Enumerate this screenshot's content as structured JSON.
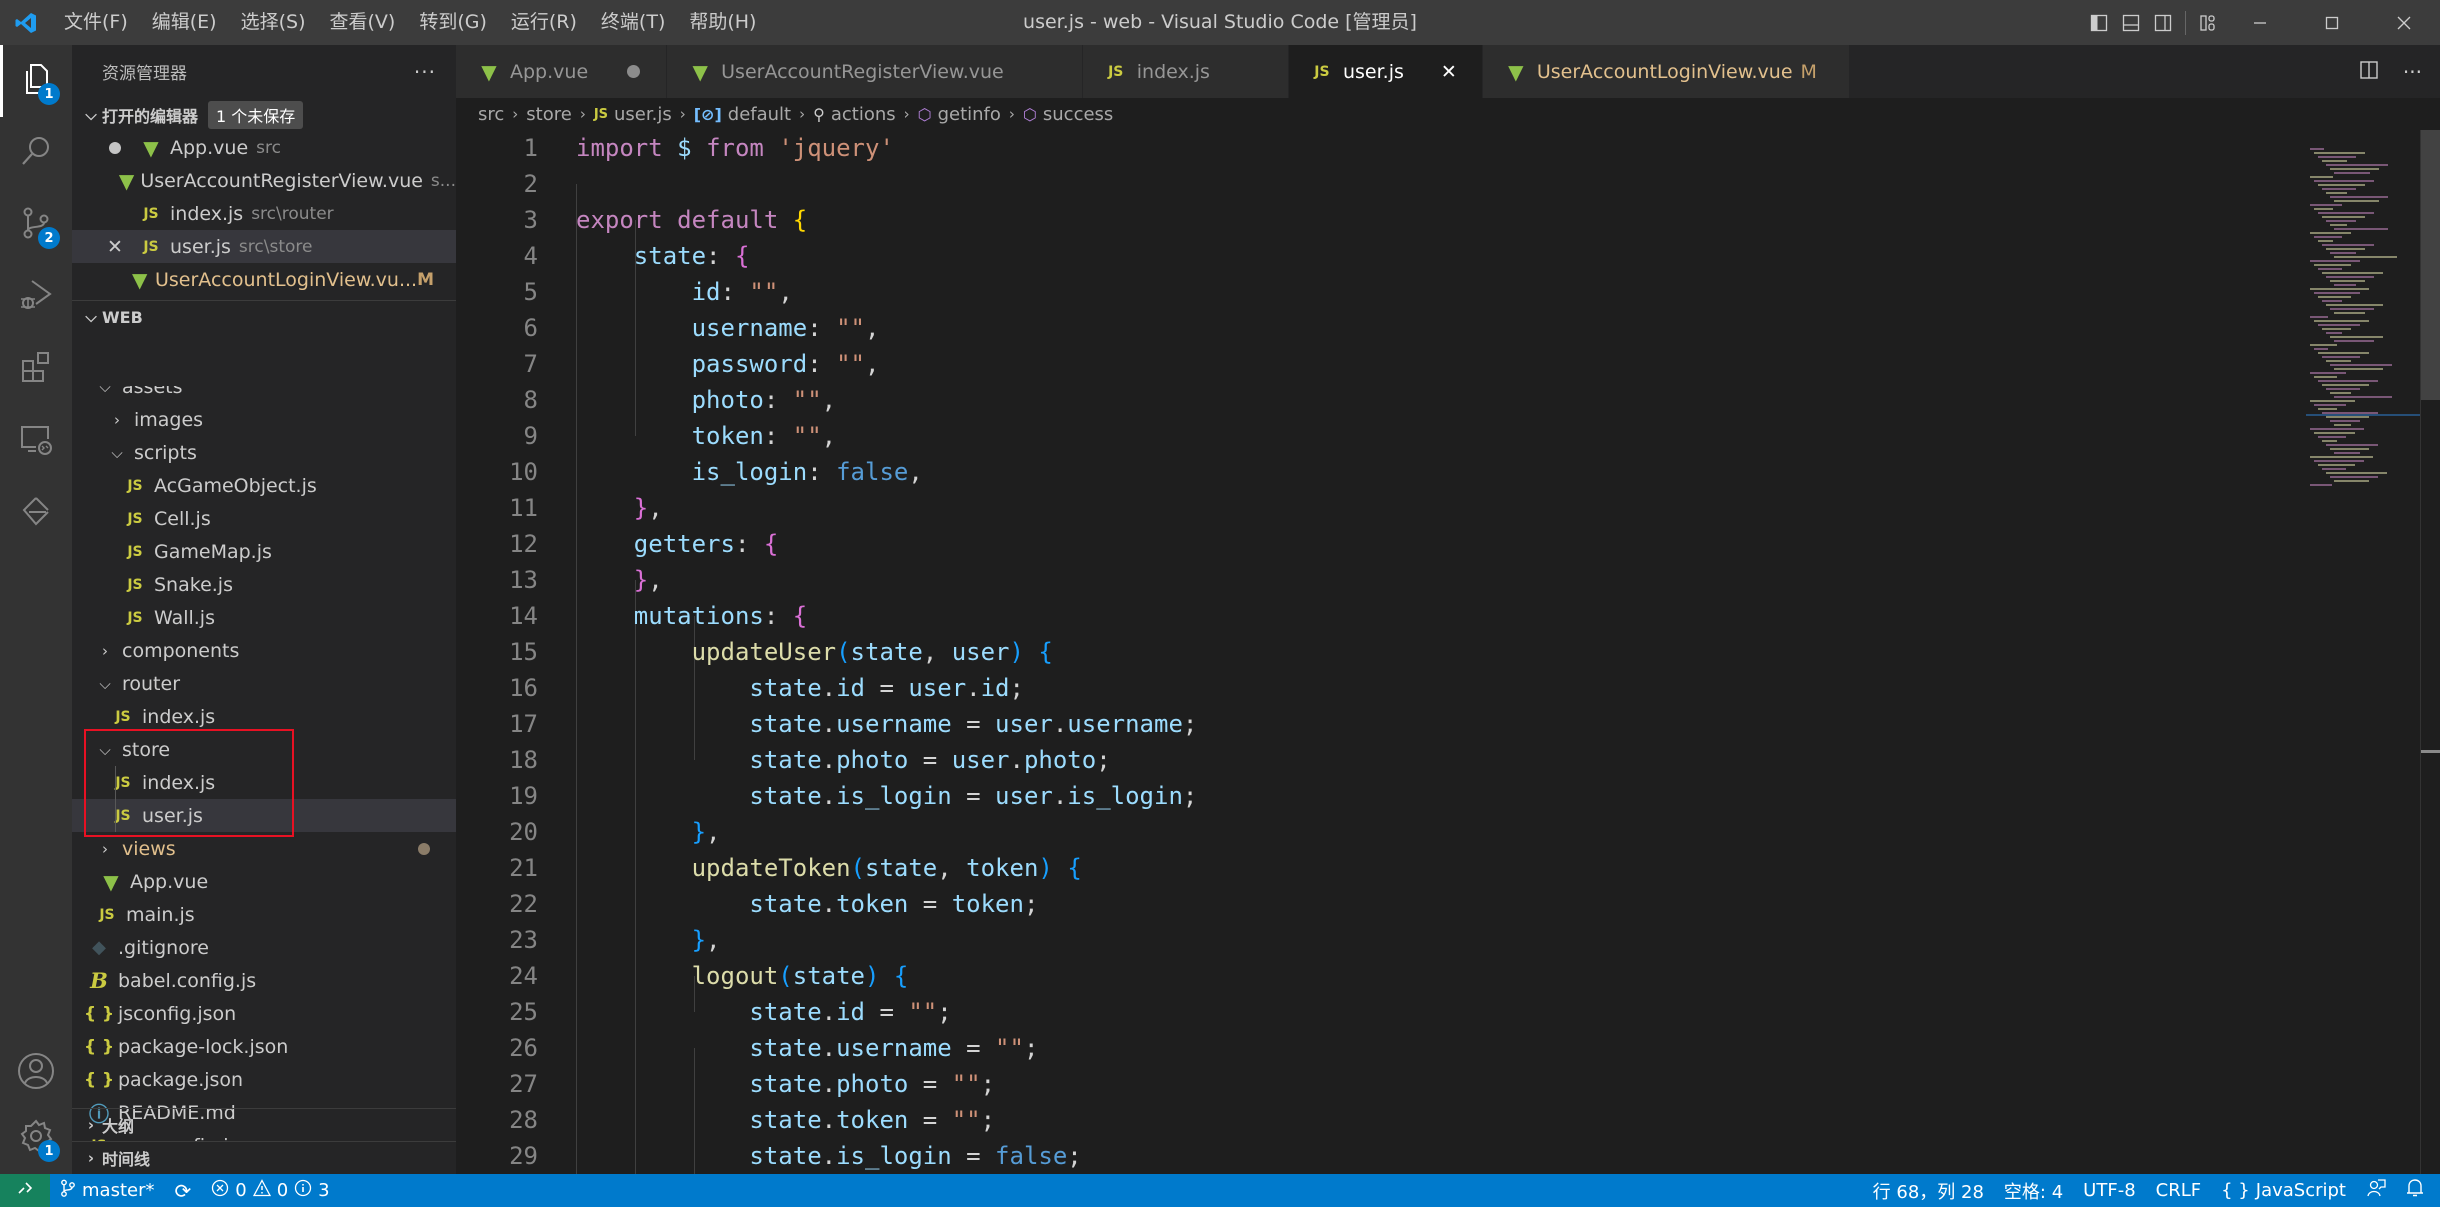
{
  "titlebar": {
    "menu": [
      "文件(F)",
      "编辑(E)",
      "选择(S)",
      "查看(V)",
      "转到(G)",
      "运行(R)",
      "终端(T)",
      "帮助(H)"
    ],
    "window_title": "user.js - web - Visual Studio Code [管理员]"
  },
  "activitybar": {
    "explorer_badge": "1",
    "scm_badge": "2",
    "settings_badge": "1"
  },
  "sidebar": {
    "title": "资源管理器",
    "more": "···",
    "open_editors": {
      "label": "打开的编辑器",
      "unsaved_badge": "1 个未保存",
      "items": [
        {
          "name": "App.vue",
          "desc": "src",
          "type": "vue",
          "state": "dirty"
        },
        {
          "name": "UserAccountRegisterView.vue",
          "desc": "s...",
          "type": "vue",
          "state": ""
        },
        {
          "name": "index.js",
          "desc": "src\\router",
          "type": "js",
          "state": ""
        },
        {
          "name": "user.js",
          "desc": "src\\store",
          "type": "js",
          "state": "active"
        },
        {
          "name": "UserAccountLoginView.vu...",
          "desc": "M",
          "type": "vue",
          "state": "modified"
        }
      ]
    },
    "workspace": {
      "label": "WEB",
      "tree": [
        {
          "name": "assets",
          "kind": "folder-open",
          "depth": 1
        },
        {
          "name": "images",
          "kind": "folder-closed",
          "depth": 2
        },
        {
          "name": "scripts",
          "kind": "folder-open",
          "depth": 2
        },
        {
          "name": "AcGameObject.js",
          "kind": "js",
          "depth": 3
        },
        {
          "name": "Cell.js",
          "kind": "js",
          "depth": 3
        },
        {
          "name": "GameMap.js",
          "kind": "js",
          "depth": 3
        },
        {
          "name": "Snake.js",
          "kind": "js",
          "depth": 3
        },
        {
          "name": "Wall.js",
          "kind": "js",
          "depth": 3
        },
        {
          "name": "components",
          "kind": "folder-closed",
          "depth": 1
        },
        {
          "name": "router",
          "kind": "folder-open",
          "depth": 1
        },
        {
          "name": "index.js",
          "kind": "js",
          "depth": 2
        },
        {
          "name": "store",
          "kind": "folder-open",
          "depth": 1
        },
        {
          "name": "index.js",
          "kind": "js",
          "depth": 2
        },
        {
          "name": "user.js",
          "kind": "js",
          "depth": 2,
          "selected": true
        },
        {
          "name": "views",
          "kind": "folder-closed-modified",
          "depth": 1
        },
        {
          "name": "App.vue",
          "kind": "vue",
          "depth": 1
        },
        {
          "name": "main.js",
          "kind": "js",
          "depth": 1
        },
        {
          "name": ".gitignore",
          "kind": "git",
          "depth": 0
        },
        {
          "name": "babel.config.js",
          "kind": "babel",
          "depth": 0
        },
        {
          "name": "jsconfig.json",
          "kind": "json",
          "depth": 0
        },
        {
          "name": "package-lock.json",
          "kind": "json",
          "depth": 0
        },
        {
          "name": "package.json",
          "kind": "json",
          "depth": 0
        },
        {
          "name": "README.md",
          "kind": "info",
          "depth": 0
        },
        {
          "name": "vue.config.js",
          "kind": "js",
          "depth": 0
        }
      ]
    },
    "outline_label": "大纲",
    "timeline_label": "时间线"
  },
  "tabs": [
    {
      "label": "App.vue",
      "type": "vue",
      "state": "dirty"
    },
    {
      "label": "UserAccountRegisterView.vue",
      "type": "vue",
      "state": ""
    },
    {
      "label": "index.js",
      "type": "js",
      "state": ""
    },
    {
      "label": "user.js",
      "type": "js",
      "state": "active"
    },
    {
      "label": "UserAccountLoginView.vue",
      "type": "vue",
      "state": "modified",
      "flag": "M"
    }
  ],
  "breadcrumb": [
    "src",
    "store",
    "user.js",
    "default",
    "actions",
    "getinfo",
    "success"
  ],
  "code_lines": [
    [
      [
        "kw",
        "import"
      ],
      [
        "plain",
        " "
      ],
      [
        "var",
        "$"
      ],
      [
        "plain",
        " "
      ],
      [
        "kw",
        "from"
      ],
      [
        "plain",
        " "
      ],
      [
        "str",
        "'jquery'"
      ]
    ],
    [],
    [
      [
        "kw",
        "export"
      ],
      [
        "plain",
        " "
      ],
      [
        "kw",
        "default"
      ],
      [
        "plain",
        " "
      ],
      [
        "b1",
        "{"
      ]
    ],
    [
      [
        "plain",
        "    "
      ],
      [
        "var",
        "state"
      ],
      [
        "plain",
        ": "
      ],
      [
        "b2",
        "{"
      ]
    ],
    [
      [
        "plain",
        "        "
      ],
      [
        "var",
        "id"
      ],
      [
        "plain",
        ": "
      ],
      [
        "str",
        "\"\""
      ],
      [
        "plain",
        ","
      ]
    ],
    [
      [
        "plain",
        "        "
      ],
      [
        "var",
        "username"
      ],
      [
        "plain",
        ": "
      ],
      [
        "str",
        "\"\""
      ],
      [
        "plain",
        ","
      ]
    ],
    [
      [
        "plain",
        "        "
      ],
      [
        "var",
        "password"
      ],
      [
        "plain",
        ": "
      ],
      [
        "str",
        "\"\""
      ],
      [
        "plain",
        ","
      ]
    ],
    [
      [
        "plain",
        "        "
      ],
      [
        "var",
        "photo"
      ],
      [
        "plain",
        ": "
      ],
      [
        "str",
        "\"\""
      ],
      [
        "plain",
        ","
      ]
    ],
    [
      [
        "plain",
        "        "
      ],
      [
        "var",
        "token"
      ],
      [
        "plain",
        ": "
      ],
      [
        "str",
        "\"\""
      ],
      [
        "plain",
        ","
      ]
    ],
    [
      [
        "plain",
        "        "
      ],
      [
        "var",
        "is_login"
      ],
      [
        "plain",
        ": "
      ],
      [
        "bool",
        "false"
      ],
      [
        "plain",
        ","
      ]
    ],
    [
      [
        "plain",
        "    "
      ],
      [
        "b2",
        "}"
      ],
      [
        "plain",
        ","
      ]
    ],
    [
      [
        "plain",
        "    "
      ],
      [
        "var",
        "getters"
      ],
      [
        "plain",
        ": "
      ],
      [
        "b2",
        "{"
      ]
    ],
    [
      [
        "plain",
        "    "
      ],
      [
        "b2",
        "}"
      ],
      [
        "plain",
        ","
      ]
    ],
    [
      [
        "plain",
        "    "
      ],
      [
        "var",
        "mutations"
      ],
      [
        "plain",
        ": "
      ],
      [
        "b2",
        "{"
      ]
    ],
    [
      [
        "plain",
        "        "
      ],
      [
        "fn",
        "updateUser"
      ],
      [
        "b3",
        "("
      ],
      [
        "var",
        "state"
      ],
      [
        "plain",
        ", "
      ],
      [
        "var",
        "user"
      ],
      [
        "b3",
        ")"
      ],
      [
        "plain",
        " "
      ],
      [
        "b3",
        "{"
      ]
    ],
    [
      [
        "plain",
        "            "
      ],
      [
        "var",
        "state"
      ],
      [
        "plain",
        "."
      ],
      [
        "var",
        "id"
      ],
      [
        "plain",
        " = "
      ],
      [
        "var",
        "user"
      ],
      [
        "plain",
        "."
      ],
      [
        "var",
        "id"
      ],
      [
        "plain",
        ";"
      ]
    ],
    [
      [
        "plain",
        "            "
      ],
      [
        "var",
        "state"
      ],
      [
        "plain",
        "."
      ],
      [
        "var",
        "username"
      ],
      [
        "plain",
        " = "
      ],
      [
        "var",
        "user"
      ],
      [
        "plain",
        "."
      ],
      [
        "var",
        "username"
      ],
      [
        "plain",
        ";"
      ]
    ],
    [
      [
        "plain",
        "            "
      ],
      [
        "var",
        "state"
      ],
      [
        "plain",
        "."
      ],
      [
        "var",
        "photo"
      ],
      [
        "plain",
        " = "
      ],
      [
        "var",
        "user"
      ],
      [
        "plain",
        "."
      ],
      [
        "var",
        "photo"
      ],
      [
        "plain",
        ";"
      ]
    ],
    [
      [
        "plain",
        "            "
      ],
      [
        "var",
        "state"
      ],
      [
        "plain",
        "."
      ],
      [
        "var",
        "is_login"
      ],
      [
        "plain",
        " = "
      ],
      [
        "var",
        "user"
      ],
      [
        "plain",
        "."
      ],
      [
        "var",
        "is_login"
      ],
      [
        "plain",
        ";"
      ]
    ],
    [
      [
        "plain",
        "        "
      ],
      [
        "b3",
        "}"
      ],
      [
        "plain",
        ","
      ]
    ],
    [
      [
        "plain",
        "        "
      ],
      [
        "fn",
        "updateToken"
      ],
      [
        "b3",
        "("
      ],
      [
        "var",
        "state"
      ],
      [
        "plain",
        ", "
      ],
      [
        "var",
        "token"
      ],
      [
        "b3",
        ")"
      ],
      [
        "plain",
        " "
      ],
      [
        "b3",
        "{"
      ]
    ],
    [
      [
        "plain",
        "            "
      ],
      [
        "var",
        "state"
      ],
      [
        "plain",
        "."
      ],
      [
        "var",
        "token"
      ],
      [
        "plain",
        " = "
      ],
      [
        "var",
        "token"
      ],
      [
        "plain",
        ";"
      ]
    ],
    [
      [
        "plain",
        "        "
      ],
      [
        "b3",
        "}"
      ],
      [
        "plain",
        ","
      ]
    ],
    [
      [
        "plain",
        "        "
      ],
      [
        "fn",
        "logout"
      ],
      [
        "b3",
        "("
      ],
      [
        "var",
        "state"
      ],
      [
        "b3",
        ")"
      ],
      [
        "plain",
        " "
      ],
      [
        "b3",
        "{"
      ]
    ],
    [
      [
        "plain",
        "            "
      ],
      [
        "var",
        "state"
      ],
      [
        "plain",
        "."
      ],
      [
        "var",
        "id"
      ],
      [
        "plain",
        " = "
      ],
      [
        "str",
        "\"\""
      ],
      [
        "plain",
        ";"
      ]
    ],
    [
      [
        "plain",
        "            "
      ],
      [
        "var",
        "state"
      ],
      [
        "plain",
        "."
      ],
      [
        "var",
        "username"
      ],
      [
        "plain",
        " = "
      ],
      [
        "str",
        "\"\""
      ],
      [
        "plain",
        ";"
      ]
    ],
    [
      [
        "plain",
        "            "
      ],
      [
        "var",
        "state"
      ],
      [
        "plain",
        "."
      ],
      [
        "var",
        "photo"
      ],
      [
        "plain",
        " = "
      ],
      [
        "str",
        "\"\""
      ],
      [
        "plain",
        ";"
      ]
    ],
    [
      [
        "plain",
        "            "
      ],
      [
        "var",
        "state"
      ],
      [
        "plain",
        "."
      ],
      [
        "var",
        "token"
      ],
      [
        "plain",
        " = "
      ],
      [
        "str",
        "\"\""
      ],
      [
        "plain",
        ";"
      ]
    ],
    [
      [
        "plain",
        "            "
      ],
      [
        "var",
        "state"
      ],
      [
        "plain",
        "."
      ],
      [
        "var",
        "is_login"
      ],
      [
        "plain",
        " = "
      ],
      [
        "bool",
        "false"
      ],
      [
        "plain",
        ";"
      ]
    ]
  ],
  "statusbar": {
    "branch": "master*",
    "errors": "0",
    "warnings": "0",
    "infos": "3",
    "cursor": "行 68，列 28",
    "indent": "空格: 4",
    "encoding": "UTF-8",
    "eol": "CRLF",
    "language": "JavaScript"
  },
  "colors": {
    "accent": "#007acc",
    "remote": "#16825d",
    "highlight_box": "#e81123",
    "modified": "#e2c08d"
  }
}
